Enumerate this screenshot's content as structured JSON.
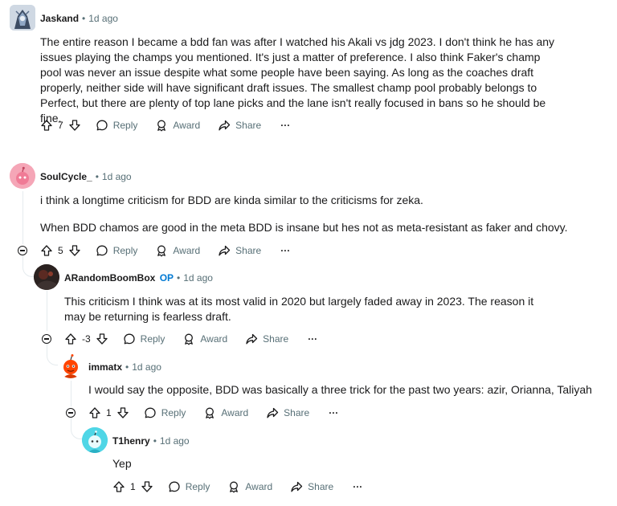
{
  "colors": {
    "text": "#1a1a1b",
    "meta": "#576f76",
    "op": "#0079d3",
    "thread": "#e5ebee"
  },
  "actions_labels": {
    "reply": "Reply",
    "award": "Award",
    "share": "Share",
    "more": "···"
  },
  "separator": "•",
  "comments": [
    {
      "username": "Jaskand",
      "time": "1d ago",
      "paragraphs": [
        "The entire reason I became a bdd fan was after I watched his Akali vs jdg 2023. I don't think he has any issues playing the champs you mentioned. It's just a matter of preference. I also think Faker's champ pool was never an issue despite what some people have been saying. As long as the coaches draft properly, neither side will have significant draft issues. The smallest champ pool probably belongs to Perfect, but there are plenty of top lane picks and the lane isn't really focused in bans so he should be fine."
      ],
      "score": "7"
    },
    {
      "username": "SoulCycle_",
      "time": "1d ago",
      "paragraphs": [
        "i think a longtime criticism for BDD are kinda similar to the criticisms for zeka.",
        "When BDD chamos are good in the meta BDD is insane but hes not as meta-resistant as faker and chovy."
      ],
      "score": "5"
    },
    {
      "username": "ARandomBoomBox",
      "op_badge": "OP",
      "time": "1d ago",
      "paragraphs": [
        "This criticism I think was at its most valid in 2020 but largely faded away in 2023. The reason it may be returning is fearless draft."
      ],
      "score": "-3"
    },
    {
      "username": "immatx",
      "time": "1d ago",
      "paragraphs": [
        "I would say the opposite, BDD was basically a three trick for the past two years: azir, Orianna, Taliyah"
      ],
      "score": "1"
    },
    {
      "username": "T1henry",
      "time": "1d ago",
      "paragraphs": [
        "Yep"
      ],
      "score": "1"
    }
  ]
}
